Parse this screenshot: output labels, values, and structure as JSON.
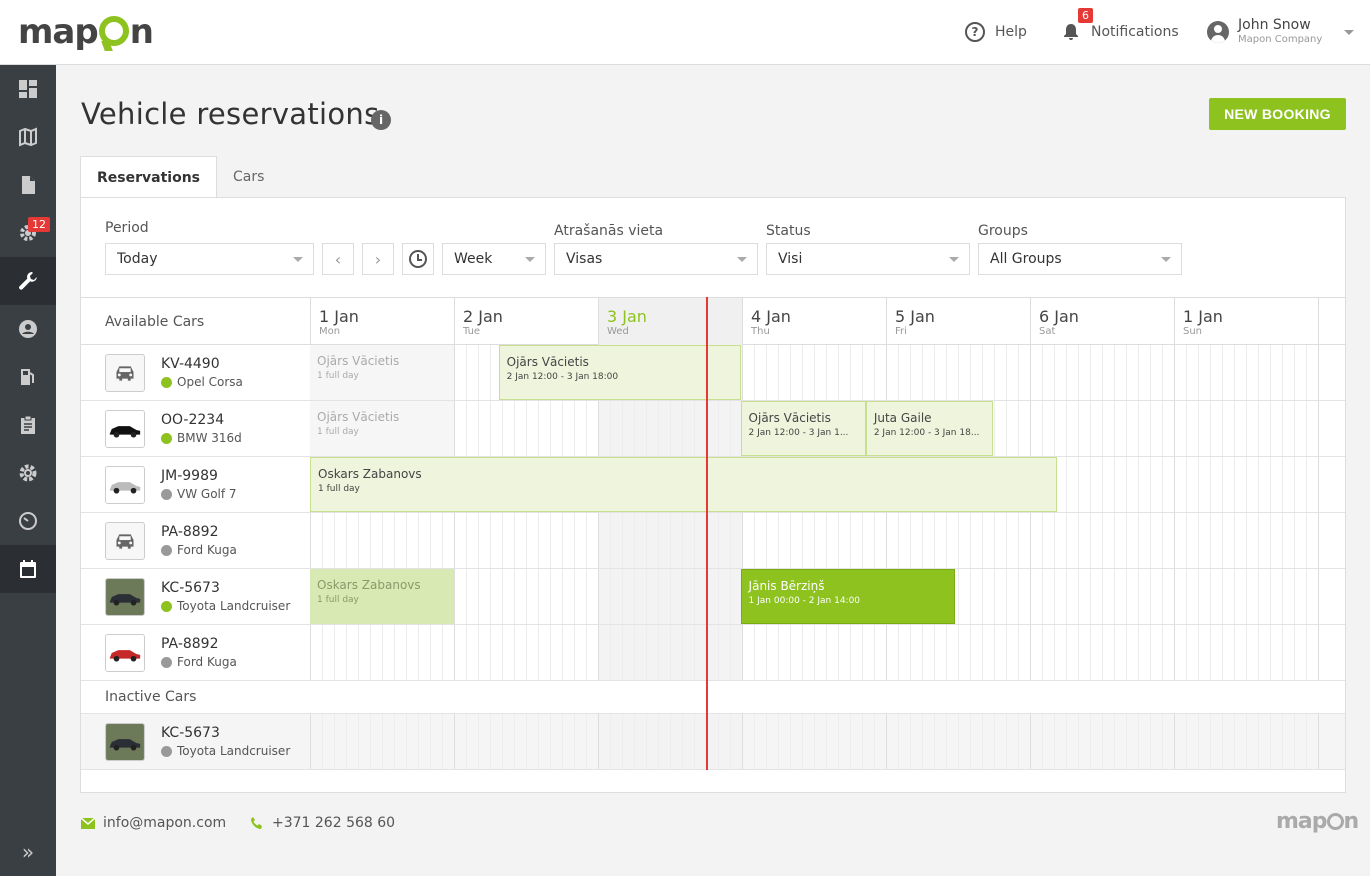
{
  "brand": {
    "logo_pre": "map",
    "logo_post": "n",
    "accent": "#8dc21f"
  },
  "topbar": {
    "help_label": "Help",
    "notifications_label": "Notifications",
    "notifications_count": "6",
    "user_name": "John Snow",
    "user_company": "Mapon Company"
  },
  "sidebar": {
    "items": [
      {
        "icon": "dashboard-icon"
      },
      {
        "icon": "map-icon"
      },
      {
        "icon": "document-icon"
      },
      {
        "icon": "cog-alert-icon",
        "badge": "12"
      },
      {
        "icon": "wrench-icon"
      },
      {
        "icon": "user-icon"
      },
      {
        "icon": "fuel-icon"
      },
      {
        "icon": "clipboard-icon"
      },
      {
        "icon": "settings-icon"
      },
      {
        "icon": "speedometer-icon"
      },
      {
        "icon": "calendar-icon"
      }
    ],
    "expand_icon": "»"
  },
  "page": {
    "title": "Vehicle reservations",
    "info": "i",
    "new_booking": "NEW BOOKING"
  },
  "tabs": [
    {
      "label": "Reservations"
    },
    {
      "label": "Cars"
    }
  ],
  "filters": {
    "period_label": "Period",
    "period_value": "Today",
    "prev": "‹",
    "next": "›",
    "range_value": "Week",
    "location_label": "Atrašanās vieta",
    "location_value": "Visas",
    "status_label": "Status",
    "status_value": "Visi",
    "groups_label": "Groups",
    "groups_value": "All Groups"
  },
  "grid": {
    "available_label": "Available Cars",
    "inactive_label": "Inactive Cars",
    "days": [
      {
        "d": "1 Jan",
        "w": "Mon"
      },
      {
        "d": "2 Jan",
        "w": "Tue"
      },
      {
        "d": "3 Jan",
        "w": "Wed",
        "today": true
      },
      {
        "d": "4 Jan",
        "w": "Thu"
      },
      {
        "d": "5 Jan",
        "w": "Fri"
      },
      {
        "d": "6 Jan",
        "w": "Sat"
      },
      {
        "d": "1 Jan",
        "w": "Sun"
      }
    ],
    "now_position_days": 2.75,
    "cars": [
      {
        "plate": "KV-4490",
        "model": "Opel Corsa",
        "home": true,
        "thumb": "placeholder"
      },
      {
        "plate": "OO-2234",
        "model": "BMW 316d",
        "home": true,
        "thumb": "black"
      },
      {
        "plate": "JM-9989",
        "model": "VW Golf 7",
        "home": false,
        "thumb": "silver"
      },
      {
        "plate": "PA-8892",
        "model": "Ford Kuga",
        "home": false,
        "thumb": "placeholder"
      },
      {
        "plate": "KC-5673",
        "model": "Toyota Landcruiser",
        "home": true,
        "thumb": "suv"
      },
      {
        "plate": "PA-8892",
        "model": "Ford Kuga",
        "home": false,
        "thumb": "red"
      }
    ],
    "inactive_cars": [
      {
        "plate": "KC-5673",
        "model": "Toyota Landcruiser",
        "home": false,
        "thumb": "suv"
      }
    ],
    "bookings": [
      {
        "row": 0,
        "start": 0,
        "end": 1,
        "name": "Ojārs Vācietis",
        "time": "1 full day",
        "style": "ghost"
      },
      {
        "row": 0,
        "start": 1.31,
        "end": 2.99,
        "name": "Ojārs Vācietis",
        "time": "2 Jan 12:00 - 3 Jan 18:00",
        "style": "light"
      },
      {
        "row": 1,
        "start": 0,
        "end": 1,
        "name": "Ojārs Vācietis",
        "time": "1 full day",
        "style": "ghost"
      },
      {
        "row": 1,
        "start": 2.99,
        "end": 3.86,
        "name": "Ojārs Vācietis",
        "time": "2 Jan 12:00 - 3 Jan 1...",
        "style": "light"
      },
      {
        "row": 1,
        "start": 3.86,
        "end": 4.74,
        "name": "Juta Gaile",
        "time": "2 Jan 12:00 - 3 Jan 18...",
        "style": "light"
      },
      {
        "row": 2,
        "start": 0,
        "end": 5.19,
        "name": "Oskars Zabanovs",
        "time": "1 full day",
        "style": "light"
      },
      {
        "row": 4,
        "start": 0,
        "end": 1,
        "name": "Oskars Zabanovs",
        "time": "1 full day",
        "style": "ghost-g"
      },
      {
        "row": 4,
        "start": 2.99,
        "end": 4.48,
        "name": "Jānis Bērziņš",
        "time": "1 Jan 00:00 - 2 Jan 14:00",
        "style": "strong"
      }
    ]
  },
  "footer": {
    "email": "info@mapon.com",
    "phone": "+371 262 568 60",
    "logo_pre": "map",
    "logo_post": "n"
  }
}
